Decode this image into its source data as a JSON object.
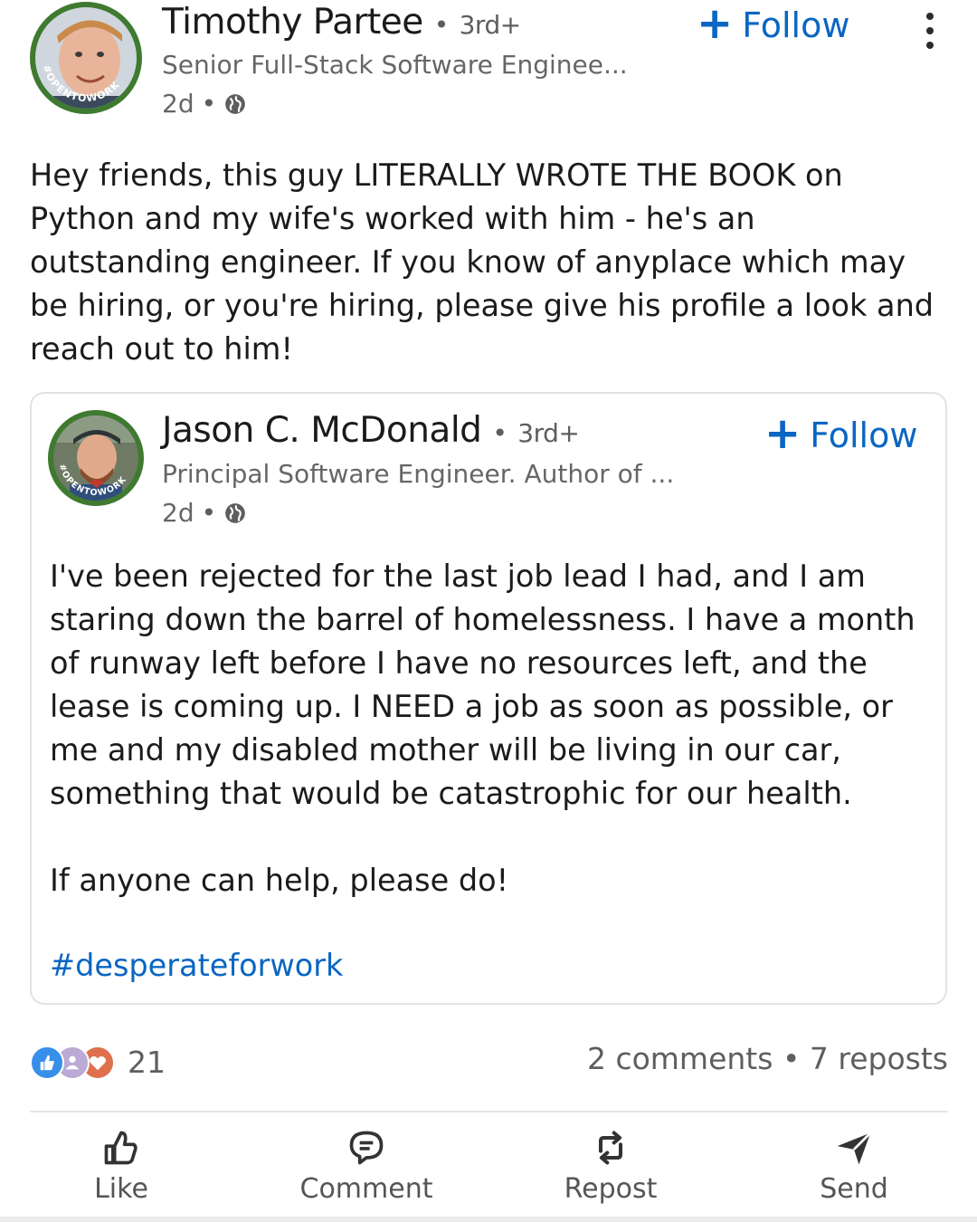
{
  "post": {
    "author": {
      "name": "Timothy Partee",
      "degree": "3rd+",
      "headline": "Senior Full-Stack Software Enginee...",
      "time": "2d",
      "badge": "#OPENTOWORK"
    },
    "follow_label": "Follow",
    "text": "Hey friends, this guy LITERALLY WROTE THE BOOK on Python and my wife's worked with him - he's an outstanding engineer. If you know of anyplace which may be hiring, or you're hiring, please give his profile a look and reach out to him!",
    "shared": {
      "author": {
        "name": "Jason C. McDonald",
        "degree": "3rd+",
        "headline": "Principal Software Engineer. Author of ...",
        "time": "2d",
        "badge": "#OPENTOWORK"
      },
      "follow_label": "Follow",
      "paragraph_1": "I've been rejected for the last job lead I had, and I am staring down the barrel of homelessness. I have a month of runway left before I have no resources left, and the lease is coming up. I NEED a job as soon as possible, or me and my disabled mother will be living in our car, something that would be catastrophic for our health.",
      "paragraph_2": "If anyone can help, please do!",
      "hashtag": "#desperateforwork"
    },
    "social": {
      "reaction_count": "21",
      "comments": "2 comments",
      "separator": "•",
      "reposts": "7 reposts",
      "reaction_icons": [
        "like-icon",
        "support-icon",
        "love-icon"
      ]
    },
    "actions": {
      "like": "Like",
      "comment": "Comment",
      "repost": "Repost",
      "send": "Send"
    }
  },
  "colors": {
    "accent": "#0a66c2",
    "open_to_work": "#3f7a31",
    "secondary_text": "#666666"
  }
}
